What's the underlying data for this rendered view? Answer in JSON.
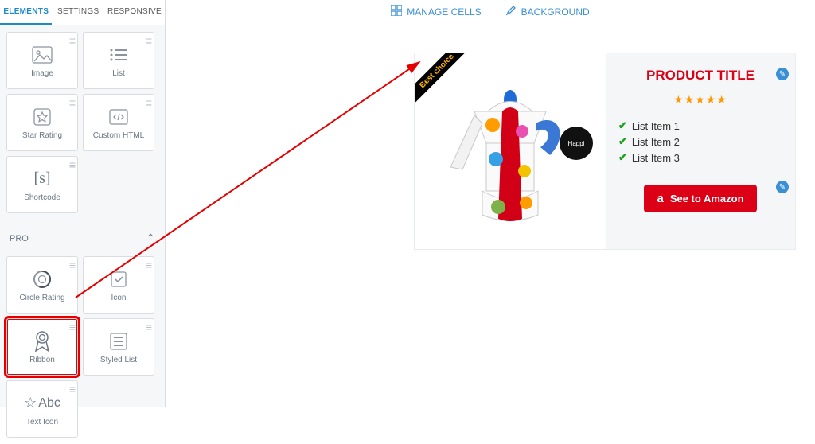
{
  "tabs": {
    "elements": "ELEMENTS",
    "settings": "SETTINGS",
    "responsive": "RESPONSIVE"
  },
  "basic_elements": {
    "image": "Image",
    "list": "List",
    "star_rating": "Star Rating",
    "custom_html": "Custom HTML",
    "shortcode": "Shortcode"
  },
  "pro_section": {
    "label": "PRO"
  },
  "pro_elements": {
    "circle_rating": "Circle Rating",
    "icon": "Icon",
    "ribbon": "Ribbon",
    "styled_list": "Styled List",
    "text_icon": "Text Icon"
  },
  "toolbar": {
    "manage_cells": "MANAGE CELLS",
    "background": "BACKGROUND"
  },
  "product": {
    "ribbon_text": "Best choice",
    "title": "PRODUCT TITLE",
    "items": [
      "List Item 1",
      "List Item 2",
      "List Item 3"
    ],
    "cta": "See to Amazon",
    "badge": "Happi"
  },
  "colors": {
    "accent_red": "#dc0016",
    "annotation_red": "#e40000",
    "link_blue": "#3b8fd4",
    "star_orange": "#ff9800",
    "check_green": "#18a21c"
  }
}
